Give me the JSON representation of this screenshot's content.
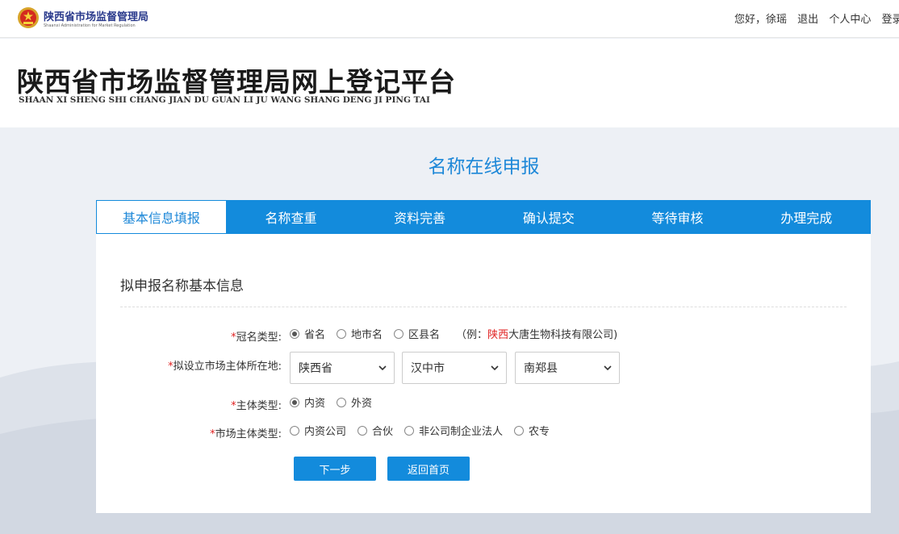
{
  "header": {
    "org_name": "陕西省市场监督管理局",
    "org_name_en": "Shaanxi Administration for Market Regulation",
    "greeting": "您好，徐瑶",
    "logout": "退出",
    "profile": "个人中心",
    "login": "登录"
  },
  "banner": {
    "title": "陕西省市场监督管理局网上登记平台",
    "subtitle": "SHAAN XI SHENG SHI CHANG JIAN DU GUAN LI JU WANG SHANG DENG JI PING TAI"
  },
  "page_heading": "名称在线申报",
  "steps": [
    {
      "label": "基本信息填报",
      "active": true
    },
    {
      "label": "名称查重"
    },
    {
      "label": "资料完善"
    },
    {
      "label": "确认提交"
    },
    {
      "label": "等待审核"
    },
    {
      "label": "办理完成"
    }
  ],
  "form": {
    "section_title": "拟申报名称基本信息",
    "required_mark": "*",
    "prefix_type": {
      "label": "冠名类型:",
      "options": [
        "省名",
        "地市名",
        "区县名"
      ],
      "selected": 0,
      "example_prefix": "（例：",
      "example_highlight": "陕西",
      "example_rest": "大唐生物科技有限公司)"
    },
    "location": {
      "label": "拟设立市场主体所在地:",
      "province": "陕西省",
      "city": "汉中市",
      "county": "南郑县"
    },
    "entity_type": {
      "label": "主体类型:",
      "options": [
        "内资",
        "外资"
      ],
      "selected": 0
    },
    "market_entity_type": {
      "label": "市场主体类型:",
      "options": [
        "内资公司",
        "合伙",
        "非公司制企业法人",
        "农专"
      ]
    }
  },
  "buttons": {
    "next": "下一步",
    "home": "返回首页"
  },
  "colors": {
    "primary": "#138bdc",
    "heading": "#1e88d8",
    "required": "#e02020"
  }
}
